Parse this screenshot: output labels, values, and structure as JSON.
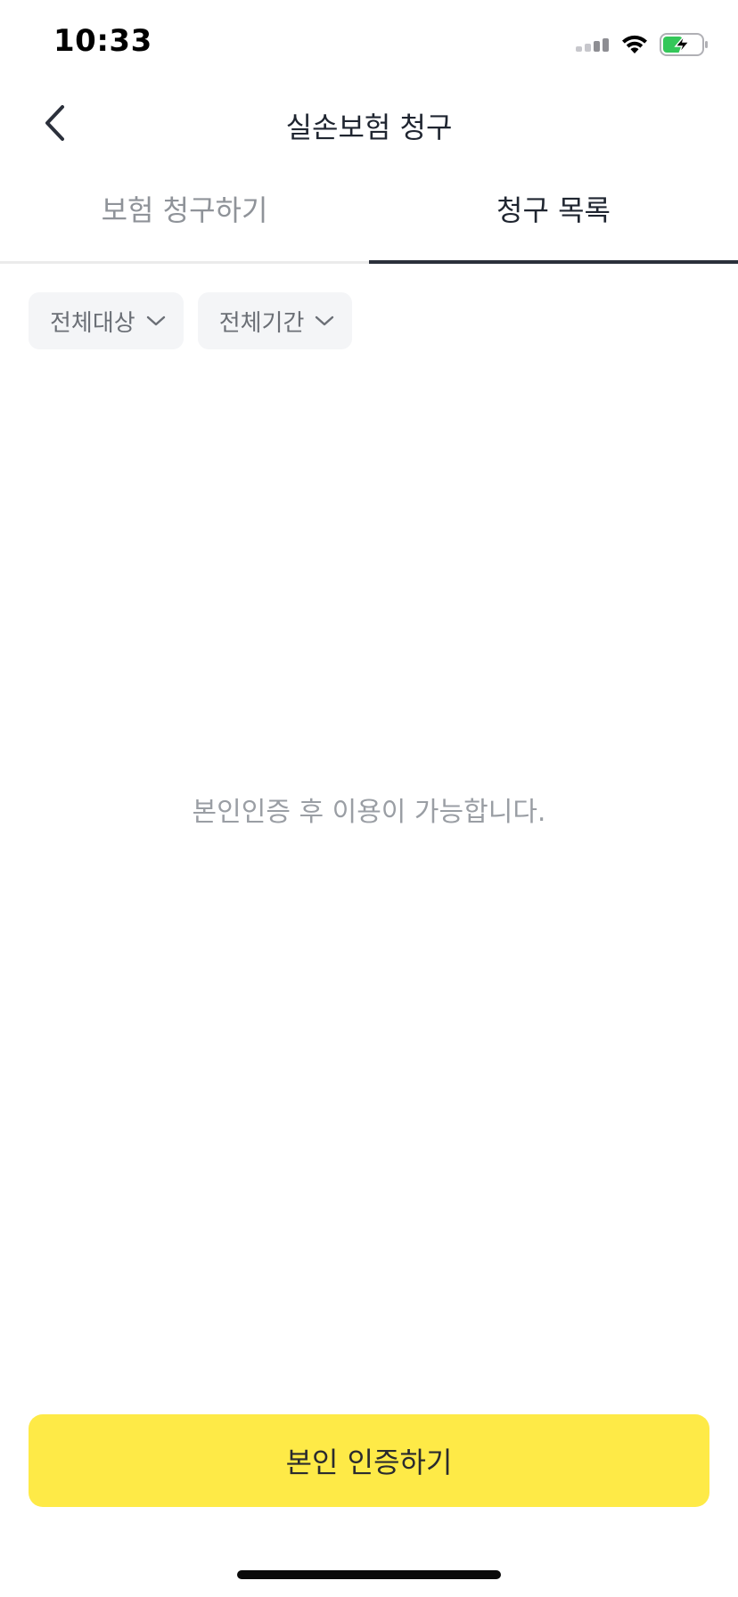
{
  "status_bar": {
    "time": "10:33",
    "icons": [
      "cellular-signal-icon",
      "wifi-icon",
      "battery-charging-icon"
    ],
    "battery_color": "#34c759"
  },
  "nav": {
    "title": "실손보험 청구",
    "back_icon": "chevron-left-icon"
  },
  "tabs": [
    {
      "label": "보험 청구하기",
      "active": false
    },
    {
      "label": "청구 목록",
      "active": true
    }
  ],
  "filters": [
    {
      "label": "전체대상",
      "icon": "chevron-down-icon"
    },
    {
      "label": "전체기간",
      "icon": "chevron-down-icon"
    }
  ],
  "empty_state": {
    "message": "본인인증 후 이용이 가능합니다."
  },
  "cta": {
    "label": "본인 인증하기",
    "color": "#feea47"
  }
}
